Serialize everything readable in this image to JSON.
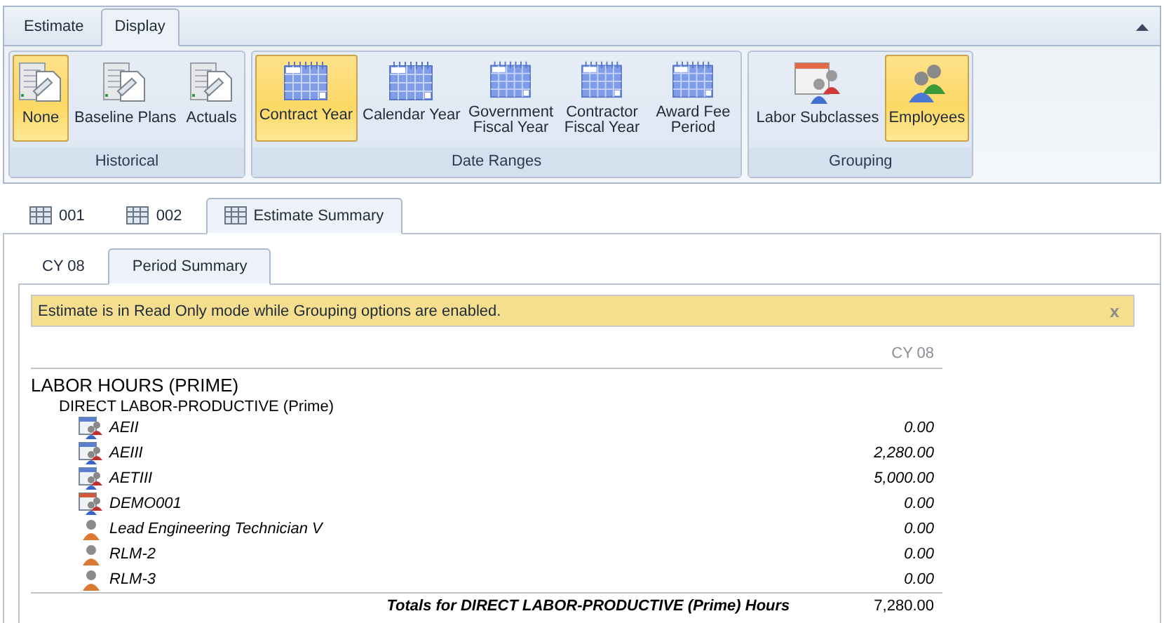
{
  "ribbon": {
    "tabs": [
      {
        "label": "Estimate",
        "selected": false
      },
      {
        "label": "Display",
        "selected": true
      }
    ],
    "groups": [
      {
        "title": "Historical",
        "buttons": [
          {
            "label": "None",
            "kind": "document",
            "selected": true
          },
          {
            "label": "Baseline Plans",
            "kind": "document",
            "selected": false
          },
          {
            "label": "Actuals",
            "kind": "document",
            "selected": false
          }
        ]
      },
      {
        "title": "Date Ranges",
        "buttons": [
          {
            "label": "Contract Year",
            "kind": "calendar",
            "selected": true
          },
          {
            "label": "Calendar Year",
            "kind": "calendar",
            "selected": false
          },
          {
            "label": "Government Fiscal Year",
            "kind": "calendar",
            "selected": false
          },
          {
            "label": "Contractor Fiscal Year",
            "kind": "calendar",
            "selected": false
          },
          {
            "label": "Award Fee Period",
            "kind": "calendar",
            "selected": false
          }
        ]
      },
      {
        "title": "Grouping",
        "buttons": [
          {
            "label": "Labor Subclasses",
            "kind": "subclasses",
            "selected": false
          },
          {
            "label": "Employees",
            "kind": "employees",
            "selected": true
          }
        ]
      }
    ]
  },
  "document_tabs": [
    {
      "label": "001",
      "selected": false
    },
    {
      "label": "002",
      "selected": false
    },
    {
      "label": "Estimate Summary",
      "selected": true
    }
  ],
  "view_tabs": [
    {
      "label": "CY 08",
      "selected": false
    },
    {
      "label": "Period Summary",
      "selected": true
    }
  ],
  "notice": {
    "text": "Estimate is in Read Only mode while Grouping options are enabled.",
    "close": "x"
  },
  "report": {
    "column": "CY 08",
    "section": "LABOR HOURS (PRIME)",
    "group": "DIRECT LABOR-PRODUCTIVE (Prime)",
    "rows": [
      {
        "kind": "subclass",
        "name": "AEII",
        "value": "0.00"
      },
      {
        "kind": "subclass",
        "name": "AEIII",
        "value": "2,280.00"
      },
      {
        "kind": "subclass",
        "name": "AETIII",
        "value": "5,000.00"
      },
      {
        "kind": "subclass-calendar",
        "name": "DEMO001",
        "value": "0.00"
      },
      {
        "kind": "employee",
        "name": "Lead Engineering Technician V",
        "value": "0.00"
      },
      {
        "kind": "employee",
        "name": "RLM-2",
        "value": "0.00"
      },
      {
        "kind": "employee",
        "name": "RLM-3",
        "value": "0.00"
      }
    ],
    "total_label": "Totals for DIRECT LABOR-PRODUCTIVE (Prime) Hours",
    "total_value": "7,280.00"
  }
}
